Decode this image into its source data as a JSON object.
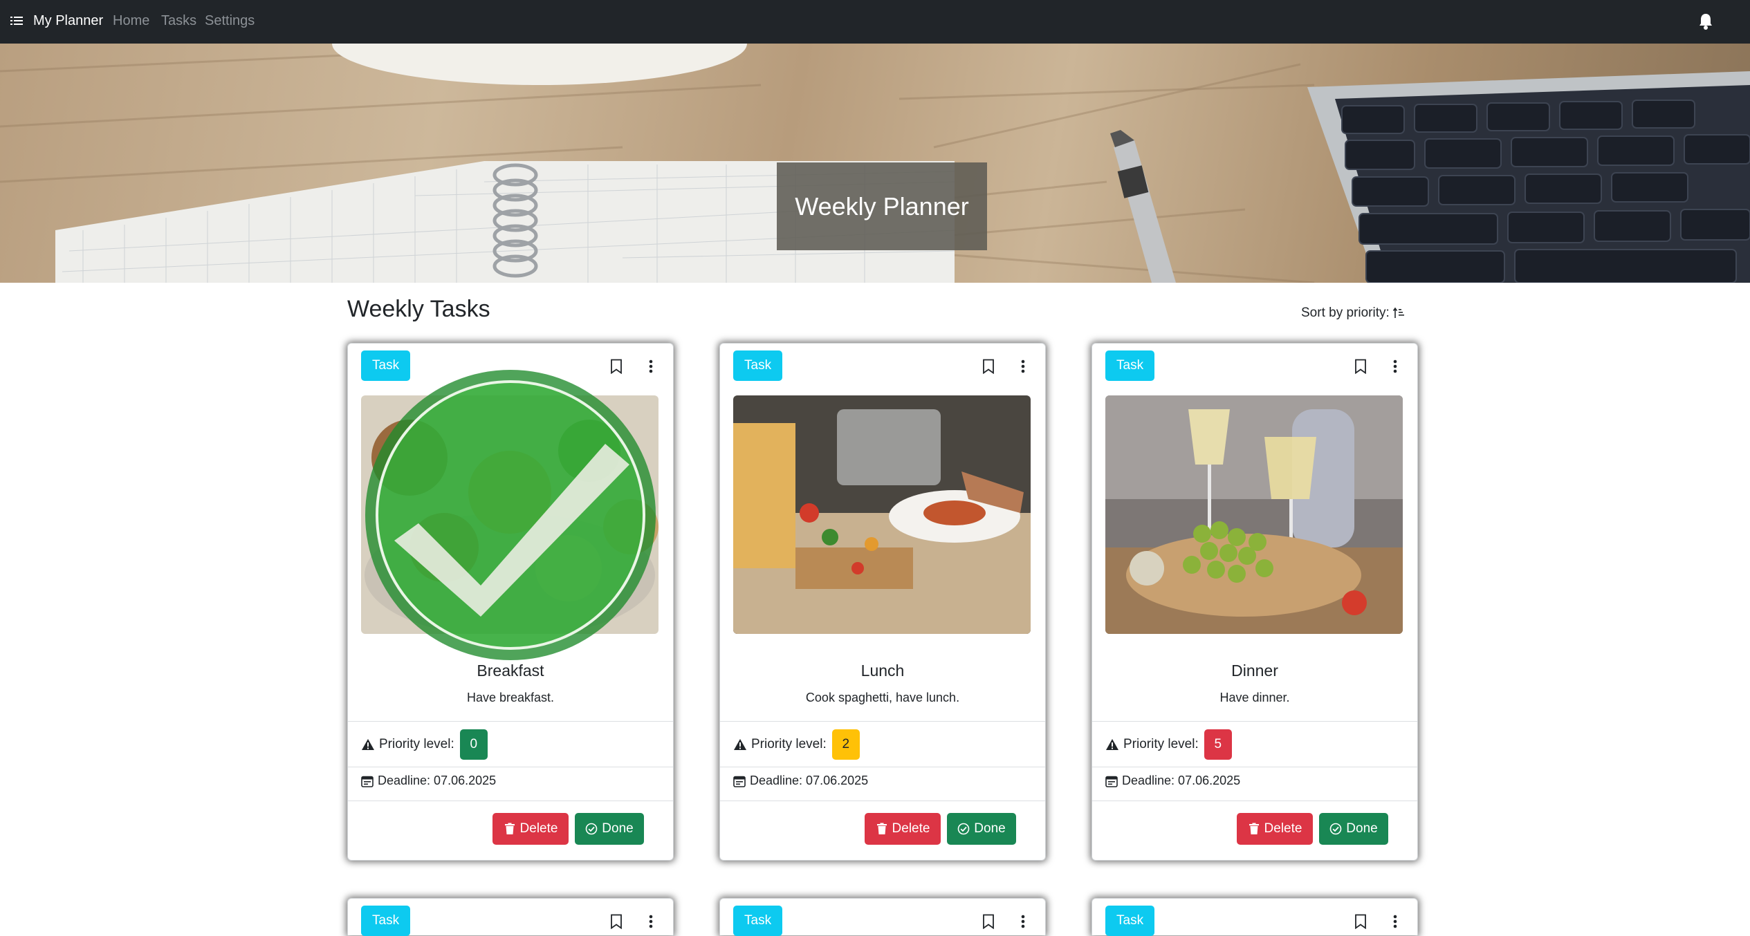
{
  "navbar": {
    "brand": "My Planner",
    "links": [
      "Home",
      "Tasks",
      "Settings"
    ],
    "menu_icon": "list-icon",
    "notification_icon": "bell-icon"
  },
  "hero": {
    "title": "Weekly Planner"
  },
  "section": {
    "title": "Weekly Tasks",
    "sort_label": "Sort by priority:",
    "sort_icon": "sort-ascending-icon"
  },
  "labels": {
    "priority": "Priority level:",
    "delete": "Delete",
    "done": "Done"
  },
  "colors": {
    "task_badge": "#0dcaf0",
    "priority_low": "#198754",
    "priority_mid": "#ffc107",
    "priority_high": "#dc3545",
    "delete": "#dc3545",
    "done": "#198754"
  },
  "cards": [
    {
      "badge": "Task",
      "title": "Breakfast",
      "description": "Have breakfast.",
      "priority": "0",
      "deadline": "Deadline: 07.06.2025",
      "completed": true
    },
    {
      "badge": "Task",
      "title": "Lunch",
      "description": "Cook spaghetti, have lunch.",
      "priority": "2",
      "deadline": "Deadline: 07.06.2025",
      "completed": false
    },
    {
      "badge": "Task",
      "title": "Dinner",
      "description": "Have dinner.",
      "priority": "5",
      "deadline": "Deadline: 07.06.2025",
      "completed": false
    },
    {
      "badge": "Task"
    },
    {
      "badge": "Task"
    },
    {
      "badge": "Task"
    }
  ]
}
